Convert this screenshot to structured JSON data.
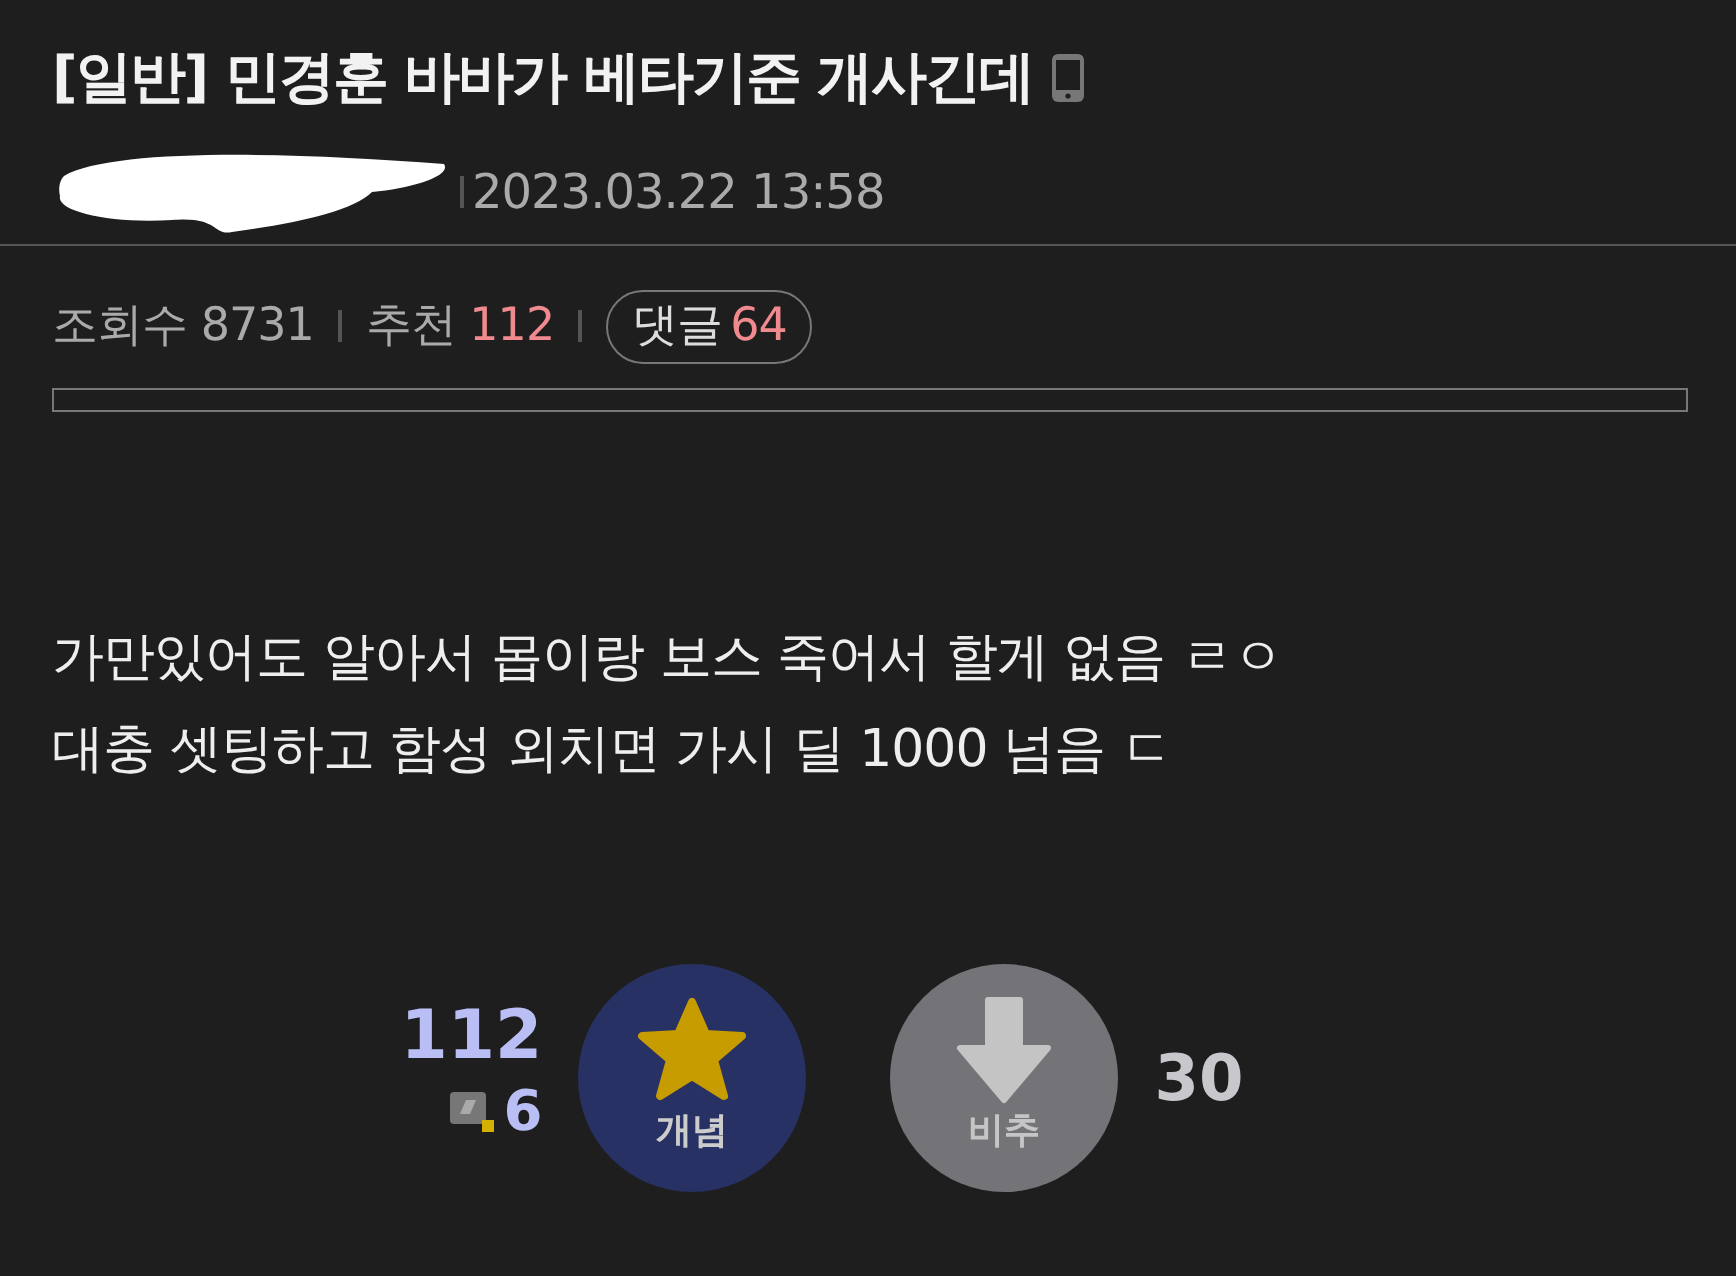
{
  "post": {
    "head": "[일반]",
    "title": "민경훈 바바가 베타기준 개사긴데",
    "datetime": "2023.03.22 13:58"
  },
  "stats": [
    {
      "kind": "plain",
      "label": "조회수",
      "value": "8731"
    },
    {
      "kind": "highlight",
      "label": "추천",
      "value": "112"
    },
    {
      "kind": "pill",
      "label": "댓글",
      "value": "64"
    }
  ],
  "body": [
    "가만있어도 알아서 몹이랑 보스 죽어서 할게 없음 ㄹㅇ",
    "대충 셋팅하고 함성 외치면 가시 딜 1000 넘음 ㄷ"
  ],
  "votes": {
    "up_count": "112",
    "fixed_count": "6",
    "up_label": "개념",
    "down_label": "비추",
    "down_count": "30"
  }
}
